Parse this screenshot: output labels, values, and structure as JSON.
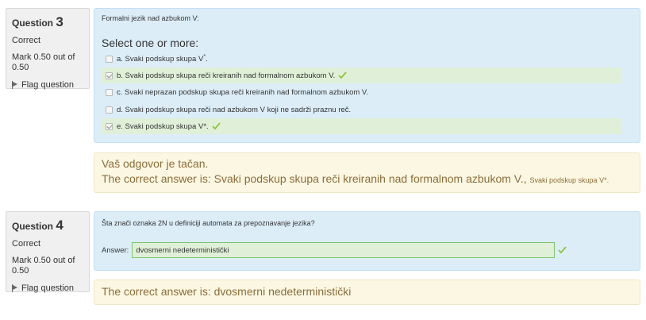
{
  "q3": {
    "label": "Question",
    "number": "3",
    "state": "Correct",
    "grade": "Mark 0.50 out of 0.50",
    "flag": "Flag question",
    "text": "Formalni jezik nad azbukom V:",
    "prompt": "Select one or more:",
    "options": [
      {
        "text": "a. Svaki podskup skupa V",
        "sup": "*",
        "suffix": ".",
        "checked": false,
        "correct": false
      },
      {
        "text": "b. Svaki podskup skupa reči kreiranih nad formalnom azbukom V.",
        "sup": "",
        "suffix": "",
        "checked": true,
        "correct": true
      },
      {
        "text": "c. Svaki neprazan podskup skupa reči kreiranih nad formalnom azbukom V.",
        "sup": "",
        "suffix": "",
        "checked": false,
        "correct": false
      },
      {
        "text": "d. Svaki podskup skupa reči nad azbukom V koji ne sadrži praznu reč.",
        "sup": "",
        "suffix": "",
        "checked": false,
        "correct": false
      },
      {
        "text": "e. Svaki podskup skupa V*.",
        "sup": "",
        "suffix": "",
        "checked": true,
        "correct": true
      }
    ],
    "feedback_general": "Vaš odgovor je tačan.",
    "feedback_answer": "The correct answer is: Svaki podskup skupa reči kreiranih nad formalnom azbukom V.,",
    "feedback_answer_small": "Svaki podskup skupa V*."
  },
  "q4": {
    "label": "Question",
    "number": "4",
    "state": "Correct",
    "grade": "Mark 0.50 out of 0.50",
    "flag": "Flag question",
    "text": "Šta znači oznaka 2N u definiciji automata za prepoznavanje jezika?",
    "answer_label": "Answer:",
    "answer_value": "dvosmerni nedeterministički",
    "feedback_answer": "The correct answer is: dvosmerni nedeterministički"
  },
  "colors": {
    "correct_bg": "#e0f0d8",
    "tick": "#8cc63f",
    "formulation_bg": "#dcedf8",
    "feedback_bg": "#fcf7e2",
    "feedback_text": "#8a6d3b"
  }
}
